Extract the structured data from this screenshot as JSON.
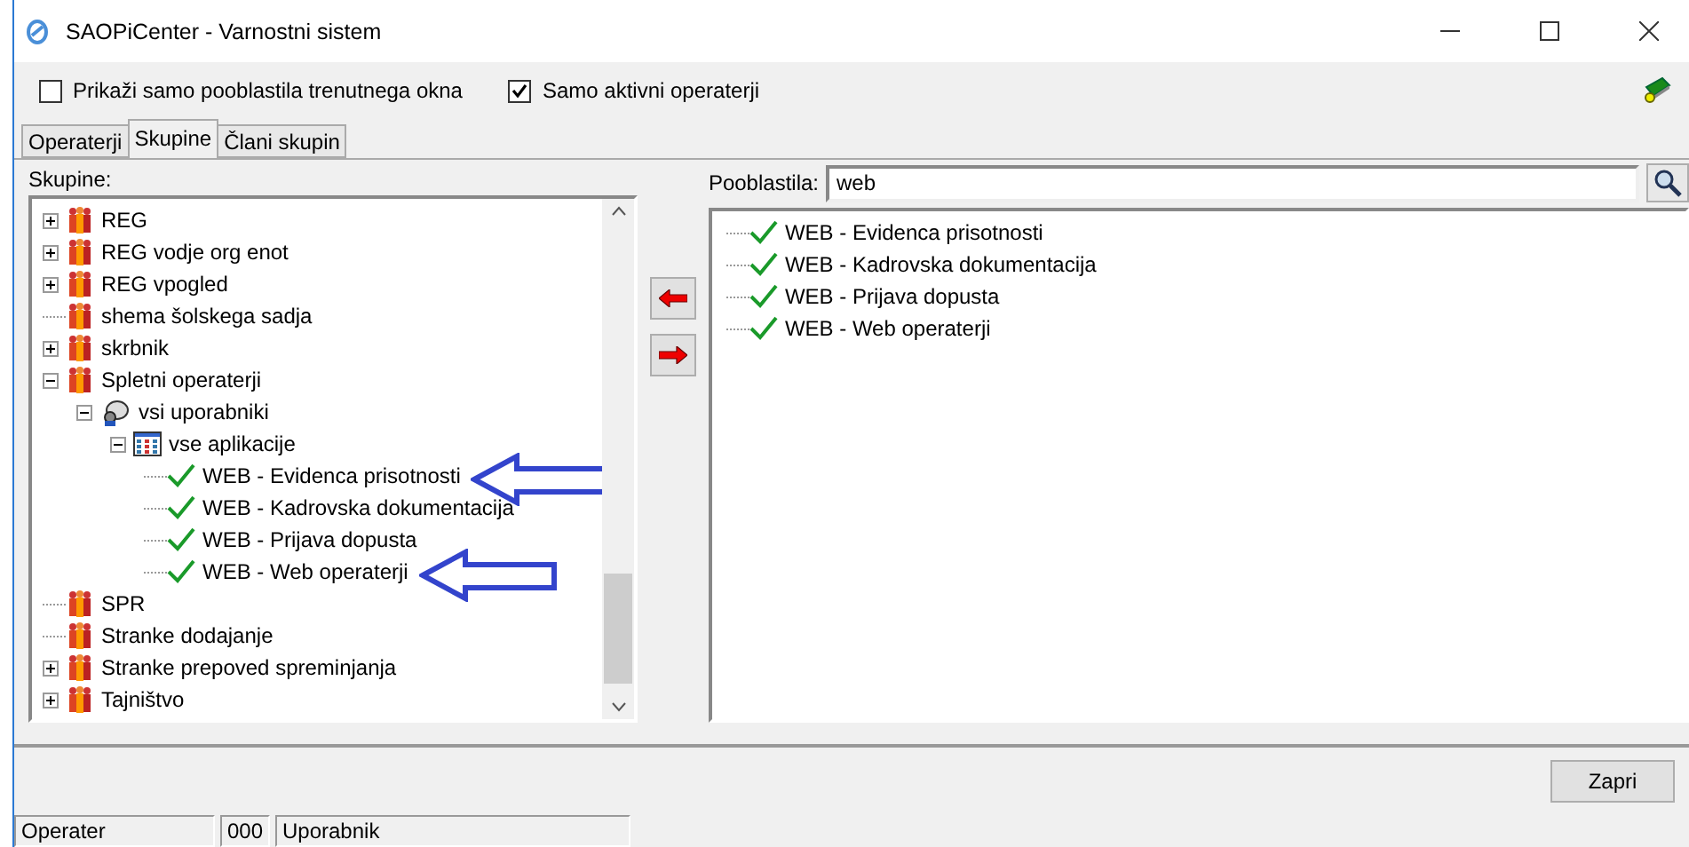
{
  "window": {
    "title": "SAOPiCenter - Varnostni sistem"
  },
  "options": [
    {
      "label": "Prikaži samo pooblastila trenutnega okna",
      "checked": false
    },
    {
      "label": "Samo aktivni operaterji",
      "checked": true
    }
  ],
  "tabs": [
    {
      "label": "Operaterji",
      "selected": false
    },
    {
      "label": "Skupine",
      "selected": true
    },
    {
      "label": "Člani skupin",
      "selected": false
    }
  ],
  "groups_panel": {
    "label": "Skupine:",
    "tree": [
      {
        "label": "REG",
        "kind": "group",
        "expandable": true,
        "expanded": false
      },
      {
        "label": "REG vodje org enot",
        "kind": "group",
        "expandable": true,
        "expanded": false
      },
      {
        "label": "REG vpogled",
        "kind": "group",
        "expandable": true,
        "expanded": false
      },
      {
        "label": "shema šolskega sadja",
        "kind": "group",
        "expandable": false
      },
      {
        "label": "skrbnik",
        "kind": "group",
        "expandable": true,
        "expanded": false
      },
      {
        "label": "Spletni operaterji",
        "kind": "group",
        "expandable": true,
        "expanded": true,
        "children": [
          {
            "label": "vsi uporabniki",
            "kind": "users",
            "expandable": true,
            "expanded": true,
            "children": [
              {
                "label": "vse aplikacije",
                "kind": "apps",
                "expandable": true,
                "expanded": true,
                "children": [
                  {
                    "label": "WEB - Evidenca prisotnosti",
                    "kind": "permission",
                    "expandable": false,
                    "annotated": true
                  },
                  {
                    "label": "WEB - Kadrovska dokumentacija",
                    "kind": "permission",
                    "expandable": false,
                    "annotated": false
                  },
                  {
                    "label": "WEB - Prijava dopusta",
                    "kind": "permission",
                    "expandable": false,
                    "annotated": false
                  },
                  {
                    "label": "WEB - Web operaterji",
                    "kind": "permission",
                    "expandable": false,
                    "annotated": true
                  }
                ]
              }
            ]
          }
        ]
      },
      {
        "label": "SPR",
        "kind": "group",
        "expandable": false
      },
      {
        "label": "Stranke dodajanje",
        "kind": "group",
        "expandable": false
      },
      {
        "label": "Stranke prepoved spreminjanja",
        "kind": "group",
        "expandable": true,
        "expanded": false
      },
      {
        "label": "Tajništvo",
        "kind": "group",
        "expandable": true,
        "expanded": false
      }
    ]
  },
  "permissions_panel": {
    "label": "Pooblastila:",
    "search_value": "web",
    "items": [
      {
        "label": "WEB - Evidenca prisotnosti"
      },
      {
        "label": "WEB - Kadrovska dokumentacija"
      },
      {
        "label": "WEB - Prijava dopusta"
      },
      {
        "label": "WEB - Web operaterji"
      }
    ]
  },
  "buttons": [
    "Zapri"
  ],
  "status_bar": [
    "Operater",
    "000",
    "Uporabnik"
  ]
}
